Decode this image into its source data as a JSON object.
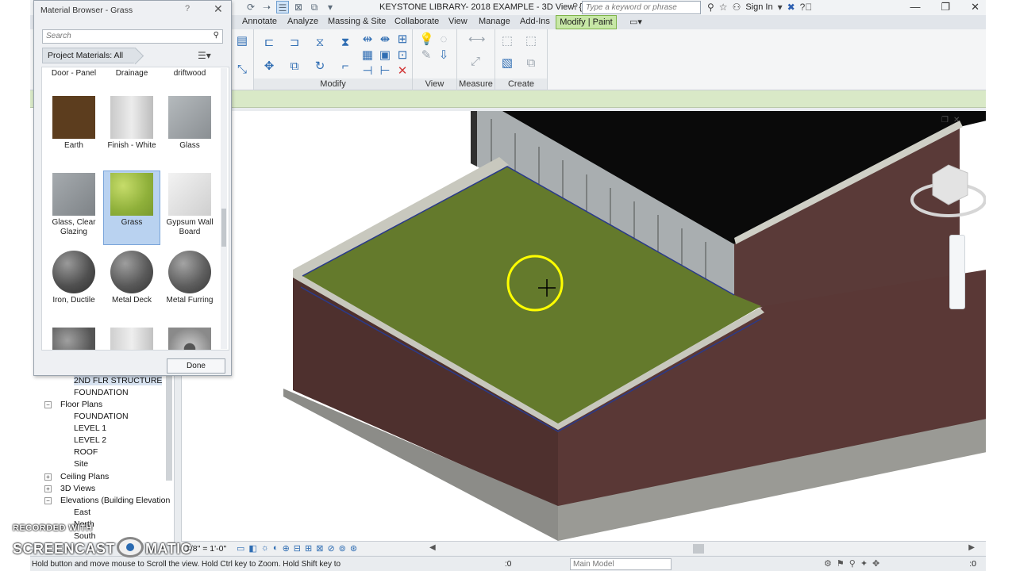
{
  "title": {
    "window": "KEYSTONE LIBRARY- 2018 EXAMPLE - 3D View: {3D}",
    "search_placeholder": "Type a keyword or phrase",
    "sign_in": "Sign In"
  },
  "tabs": [
    "Annotate",
    "Analyze",
    "Massing & Site",
    "Collaborate",
    "View",
    "Manage",
    "Add-Ins"
  ],
  "active_tab": "Modify | Paint",
  "ribbon": {
    "modify_label": "Modify",
    "view_label": "View",
    "measure_label": "Measure",
    "create_label": "Create"
  },
  "browser": {
    "items": [
      "2ND FLR STRUCTURE",
      "FOUNDATION",
      "Floor Plans",
      "FOUNDATION",
      "LEVEL 1",
      "LEVEL 2",
      "ROOF",
      "Site",
      "Ceiling Plans",
      "3D Views",
      "Elevations (Building Elevation",
      "East",
      "North",
      "South"
    ]
  },
  "view_control": {
    "scale": "1/8\" = 1'-0\""
  },
  "status": {
    "hint": "Hold button and move mouse to Scroll the view. Hold Ctrl key to Zoom. Hold Shift key to",
    "count": ":0",
    "model": "Main Model",
    "filter": ":0"
  },
  "watermark": {
    "top": "RECORDED WITH",
    "left": "SCREENCAST",
    "right": "MATIC"
  },
  "material_browser": {
    "title": "Material Browser - Grass",
    "help": "?",
    "search_placeholder": "Search",
    "filter": "Project Materials: All",
    "done": "Done",
    "tiles": [
      {
        "label": "Door - Panel",
        "color": ""
      },
      {
        "label": "Drainage",
        "color": ""
      },
      {
        "label": "driftwood",
        "color": ""
      },
      {
        "label": "Earth",
        "color": "#5c3d1e"
      },
      {
        "label": "Finish - White",
        "color": "#d8d8d8"
      },
      {
        "label": "Glass",
        "color": "#9ea4a8"
      },
      {
        "label": "Glass, Clear Glazing",
        "color": "#8f9499"
      },
      {
        "label": "Grass",
        "color": "#9fbf3f"
      },
      {
        "label": "Gypsum Wall Board",
        "color": "#e8e8e8"
      },
      {
        "label": "Iron, Ductile",
        "color": "#6e6e6e"
      },
      {
        "label": "Metal Deck",
        "color": "#747474"
      },
      {
        "label": "Metal Furring",
        "color": "#7a7a7a"
      }
    ],
    "selected": "Grass"
  },
  "colors": {
    "roof_grass": "#647a2c",
    "brick": "#5e3a36",
    "coping": "#c8c8be",
    "cursor_ring": "#ffff00",
    "active_tab": "#c7e7a6"
  }
}
